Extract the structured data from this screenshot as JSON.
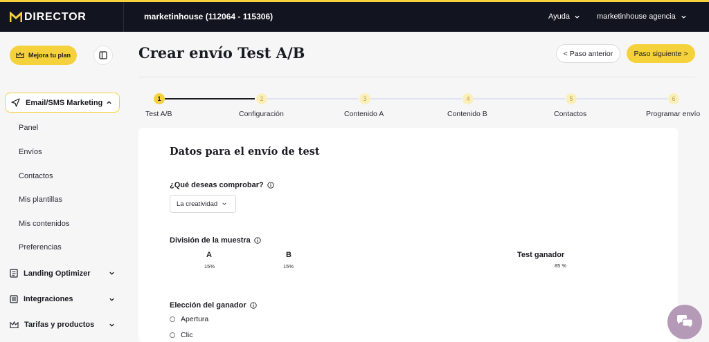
{
  "topbar": {
    "logo_text": "DIRECTOR",
    "account": "marketinhouse (112064 - 115306)",
    "help": "Ayuda",
    "agency": "marketinhouse agencia"
  },
  "sidebar": {
    "upgrade_label": "Mejora tu plan",
    "active_group": "Email/SMS Marketing",
    "subitems": [
      "Panel",
      "Envíos",
      "Contactos",
      "Mis plantillas",
      "Mis contenidos",
      "Preferencias"
    ],
    "groups": [
      "Landing Optimizer",
      "Integraciones",
      "Tarifas y productos"
    ]
  },
  "main": {
    "title": "Crear envío Test A/B",
    "prev_label": "< Paso anterior",
    "next_label": "Paso siguiente >",
    "steps": [
      {
        "num": "1",
        "label": "Test A/B"
      },
      {
        "num": "2",
        "label": "Configuración"
      },
      {
        "num": "3",
        "label": "Contenido A"
      },
      {
        "num": "4",
        "label": "Contenido B"
      },
      {
        "num": "5",
        "label": "Contactos"
      },
      {
        "num": "6",
        "label": "Programar envío"
      }
    ],
    "active_step": 1
  },
  "form": {
    "card_title": "Datos para el envío de test",
    "question_label": "¿Qué deseas comprobar?",
    "question_value": "La creatividad",
    "split_label": "División de la muestra",
    "split": {
      "a_label": "A",
      "a_value": "15%",
      "b_label": "B",
      "b_value": "15%",
      "winner_label": "Test ganador",
      "winner_value": "85 %"
    },
    "winner_choice_label": "Elección del ganador",
    "winner_options": [
      "Apertura",
      "Clic"
    ]
  },
  "colors": {
    "accent": "#f5d13c",
    "topbar": "#12141f",
    "chat": "#b59ab8"
  },
  "icons": [
    "logo-m-icon",
    "chevron-down-icon",
    "crown-icon",
    "sidebar-toggle-icon",
    "paper-plane-icon",
    "chevron-up-icon",
    "document-icon",
    "list-icon",
    "scale-icon",
    "info-icon",
    "chat-icon"
  ]
}
